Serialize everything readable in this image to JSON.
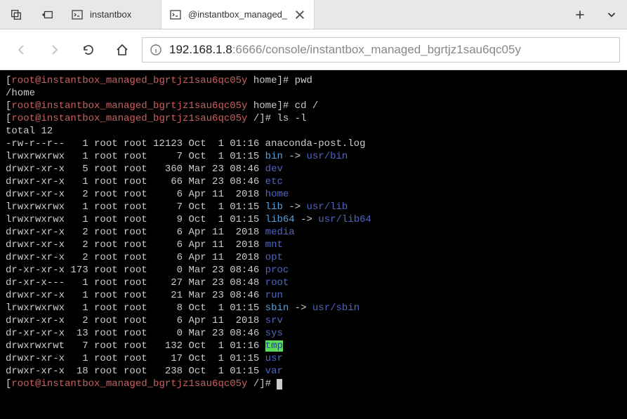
{
  "titlebar": {
    "tabs": [
      {
        "title": "instantbox"
      },
      {
        "title": "@instantbox_managed_"
      }
    ]
  },
  "navbar": {
    "url_host": "192.168.1.8",
    "url_path": ":6666/console/instantbox_managed_bgrtjz1sau6qc05y"
  },
  "terminal": {
    "prompt_user": "root@instantbox_managed_bgrtjz1sau6qc05y",
    "lines": [
      {
        "prompt_dir": "home",
        "cmd": "pwd"
      },
      {
        "out": "/home"
      },
      {
        "prompt_dir": "home",
        "cmd": "cd /"
      },
      {
        "prompt_dir": "/",
        "cmd": "ls -l"
      },
      {
        "out": "total 12"
      }
    ],
    "listing": [
      {
        "perm": "-rw-r--r--",
        "links": "1",
        "owner": "root",
        "group": "root",
        "size": "12123",
        "date": "Oct  1 01:16",
        "name": "anaconda-post.log",
        "cls": ""
      },
      {
        "perm": "lrwxrwxrwx",
        "links": "1",
        "owner": "root",
        "group": "root",
        "size": "7",
        "date": "Oct  1 01:15",
        "name": "bin",
        "cls": "cyan",
        "arrow": " -> ",
        "target": "usr/bin",
        "tcls": "blue"
      },
      {
        "perm": "drwxr-xr-x",
        "links": "5",
        "owner": "root",
        "group": "root",
        "size": "360",
        "date": "Mar 23 08:46",
        "name": "dev",
        "cls": "blue"
      },
      {
        "perm": "drwxr-xr-x",
        "links": "1",
        "owner": "root",
        "group": "root",
        "size": "66",
        "date": "Mar 23 08:46",
        "name": "etc",
        "cls": "blue"
      },
      {
        "perm": "drwxr-xr-x",
        "links": "2",
        "owner": "root",
        "group": "root",
        "size": "6",
        "date": "Apr 11  2018",
        "name": "home",
        "cls": "blue"
      },
      {
        "perm": "lrwxrwxrwx",
        "links": "1",
        "owner": "root",
        "group": "root",
        "size": "7",
        "date": "Oct  1 01:15",
        "name": "lib",
        "cls": "cyan",
        "arrow": " -> ",
        "target": "usr/lib",
        "tcls": "blue"
      },
      {
        "perm": "lrwxrwxrwx",
        "links": "1",
        "owner": "root",
        "group": "root",
        "size": "9",
        "date": "Oct  1 01:15",
        "name": "lib64",
        "cls": "cyan",
        "arrow": " -> ",
        "target": "usr/lib64",
        "tcls": "blue"
      },
      {
        "perm": "drwxr-xr-x",
        "links": "2",
        "owner": "root",
        "group": "root",
        "size": "6",
        "date": "Apr 11  2018",
        "name": "media",
        "cls": "blue"
      },
      {
        "perm": "drwxr-xr-x",
        "links": "2",
        "owner": "root",
        "group": "root",
        "size": "6",
        "date": "Apr 11  2018",
        "name": "mnt",
        "cls": "blue"
      },
      {
        "perm": "drwxr-xr-x",
        "links": "2",
        "owner": "root",
        "group": "root",
        "size": "6",
        "date": "Apr 11  2018",
        "name": "opt",
        "cls": "blue"
      },
      {
        "perm": "dr-xr-xr-x",
        "links": "173",
        "owner": "root",
        "group": "root",
        "size": "0",
        "date": "Mar 23 08:46",
        "name": "proc",
        "cls": "blue"
      },
      {
        "perm": "dr-xr-x---",
        "links": "1",
        "owner": "root",
        "group": "root",
        "size": "27",
        "date": "Mar 23 08:48",
        "name": "root",
        "cls": "blue"
      },
      {
        "perm": "drwxr-xr-x",
        "links": "1",
        "owner": "root",
        "group": "root",
        "size": "21",
        "date": "Mar 23 08:46",
        "name": "run",
        "cls": "blue"
      },
      {
        "perm": "lrwxrwxrwx",
        "links": "1",
        "owner": "root",
        "group": "root",
        "size": "8",
        "date": "Oct  1 01:15",
        "name": "sbin",
        "cls": "cyan",
        "arrow": " -> ",
        "target": "usr/sbin",
        "tcls": "blue"
      },
      {
        "perm": "drwxr-xr-x",
        "links": "2",
        "owner": "root",
        "group": "root",
        "size": "6",
        "date": "Apr 11  2018",
        "name": "srv",
        "cls": "blue"
      },
      {
        "perm": "dr-xr-xr-x",
        "links": "13",
        "owner": "root",
        "group": "root",
        "size": "0",
        "date": "Mar 23 08:46",
        "name": "sys",
        "cls": "blue"
      },
      {
        "perm": "drwxrwxrwt",
        "links": "7",
        "owner": "root",
        "group": "root",
        "size": "132",
        "date": "Oct  1 01:16",
        "name": "tmp",
        "cls": "greenbg"
      },
      {
        "perm": "drwxr-xr-x",
        "links": "1",
        "owner": "root",
        "group": "root",
        "size": "17",
        "date": "Oct  1 01:15",
        "name": "usr",
        "cls": "blue"
      },
      {
        "perm": "drwxr-xr-x",
        "links": "18",
        "owner": "root",
        "group": "root",
        "size": "238",
        "date": "Oct  1 01:15",
        "name": "var",
        "cls": "blue"
      }
    ],
    "final_prompt_dir": "/"
  }
}
